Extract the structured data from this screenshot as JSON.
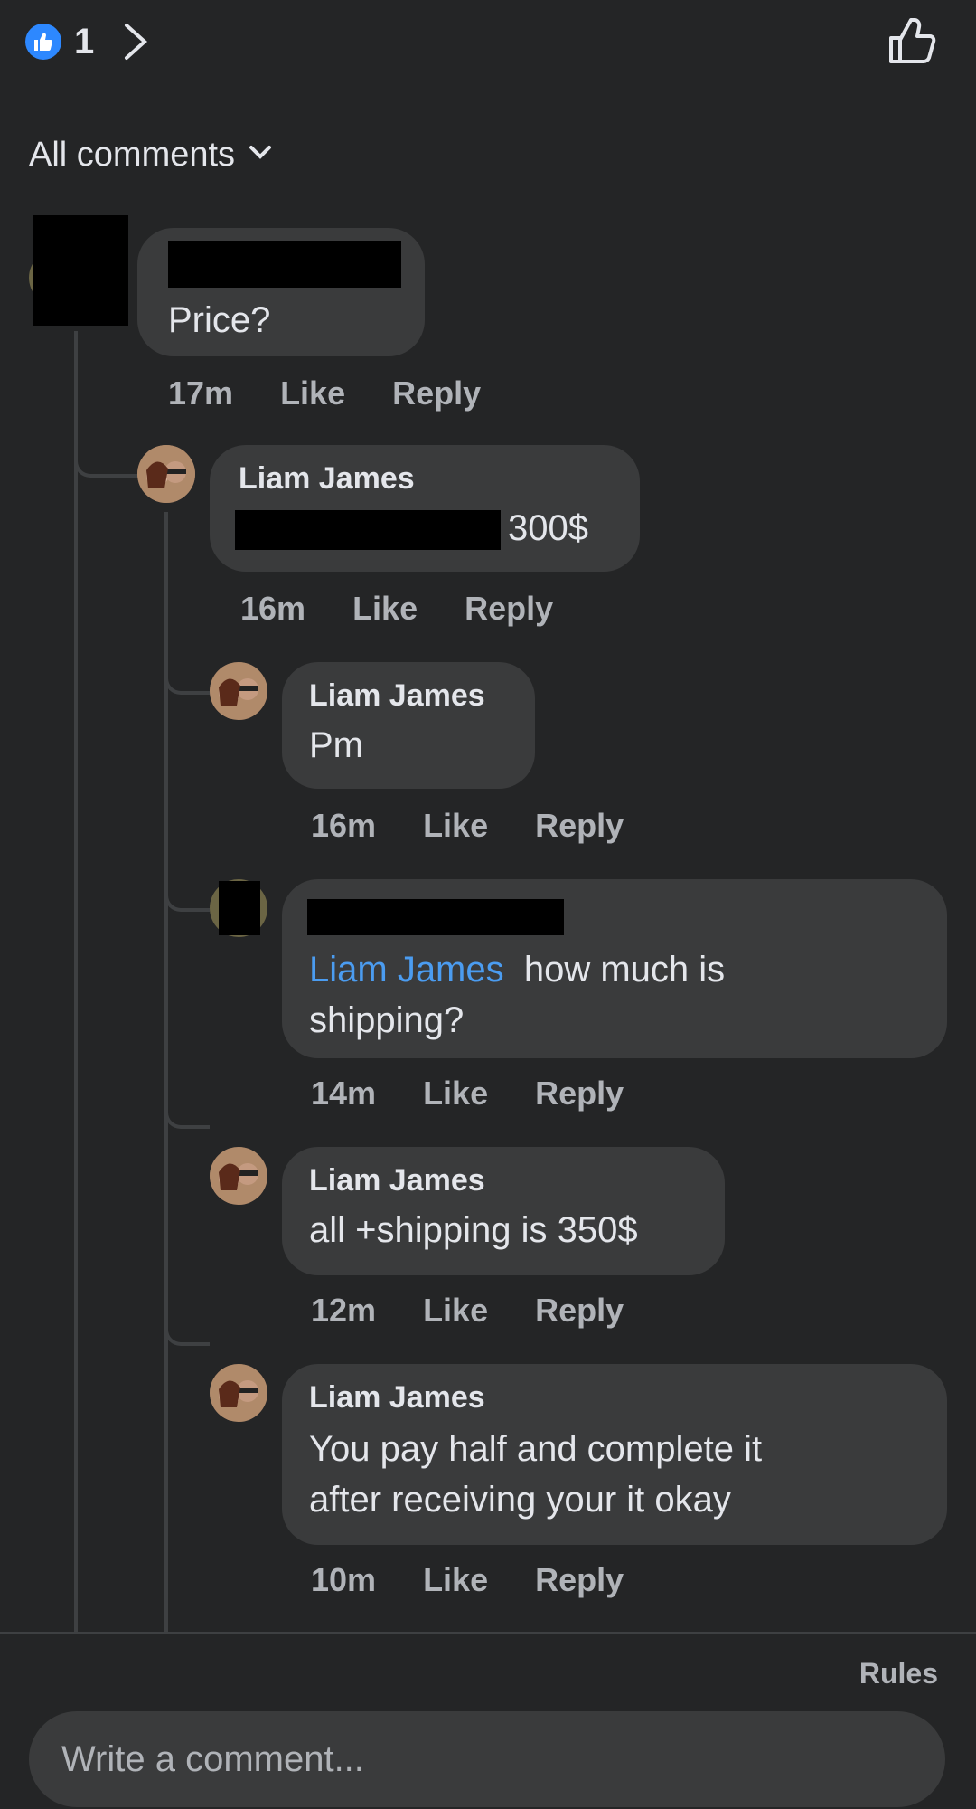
{
  "header": {
    "like_count": "1"
  },
  "sort": {
    "label": "All comments"
  },
  "comments": [
    {
      "author": "",
      "text": "Price?",
      "time": "17m",
      "like": "Like",
      "reply": "Reply"
    },
    {
      "author": "Liam James",
      "text": "300$",
      "time": "16m",
      "like": "Like",
      "reply": "Reply"
    },
    {
      "author": "Liam James",
      "text": "Pm",
      "time": "16m",
      "like": "Like",
      "reply": "Reply"
    },
    {
      "author": "",
      "mention": "Liam James",
      "text_line1": "how much is",
      "text_line2": "shipping?",
      "time": "14m",
      "like": "Like",
      "reply": "Reply"
    },
    {
      "author": "Liam James",
      "text": "all +shipping is 350$",
      "time": "12m",
      "like": "Like",
      "reply": "Reply"
    },
    {
      "author": "Liam James",
      "text_line1": "You pay half and complete it",
      "text_line2": "after receiving your it okay",
      "time": "10m",
      "like": "Like",
      "reply": "Reply"
    }
  ],
  "footer": {
    "rules": "Rules",
    "composer_placeholder": "Write a comment..."
  },
  "colors": {
    "background": "#242526",
    "bubble": "#3a3b3c",
    "mention": "#4b9cf0",
    "like_badge": "#2d88ff",
    "meta": "#b0b3b8"
  }
}
